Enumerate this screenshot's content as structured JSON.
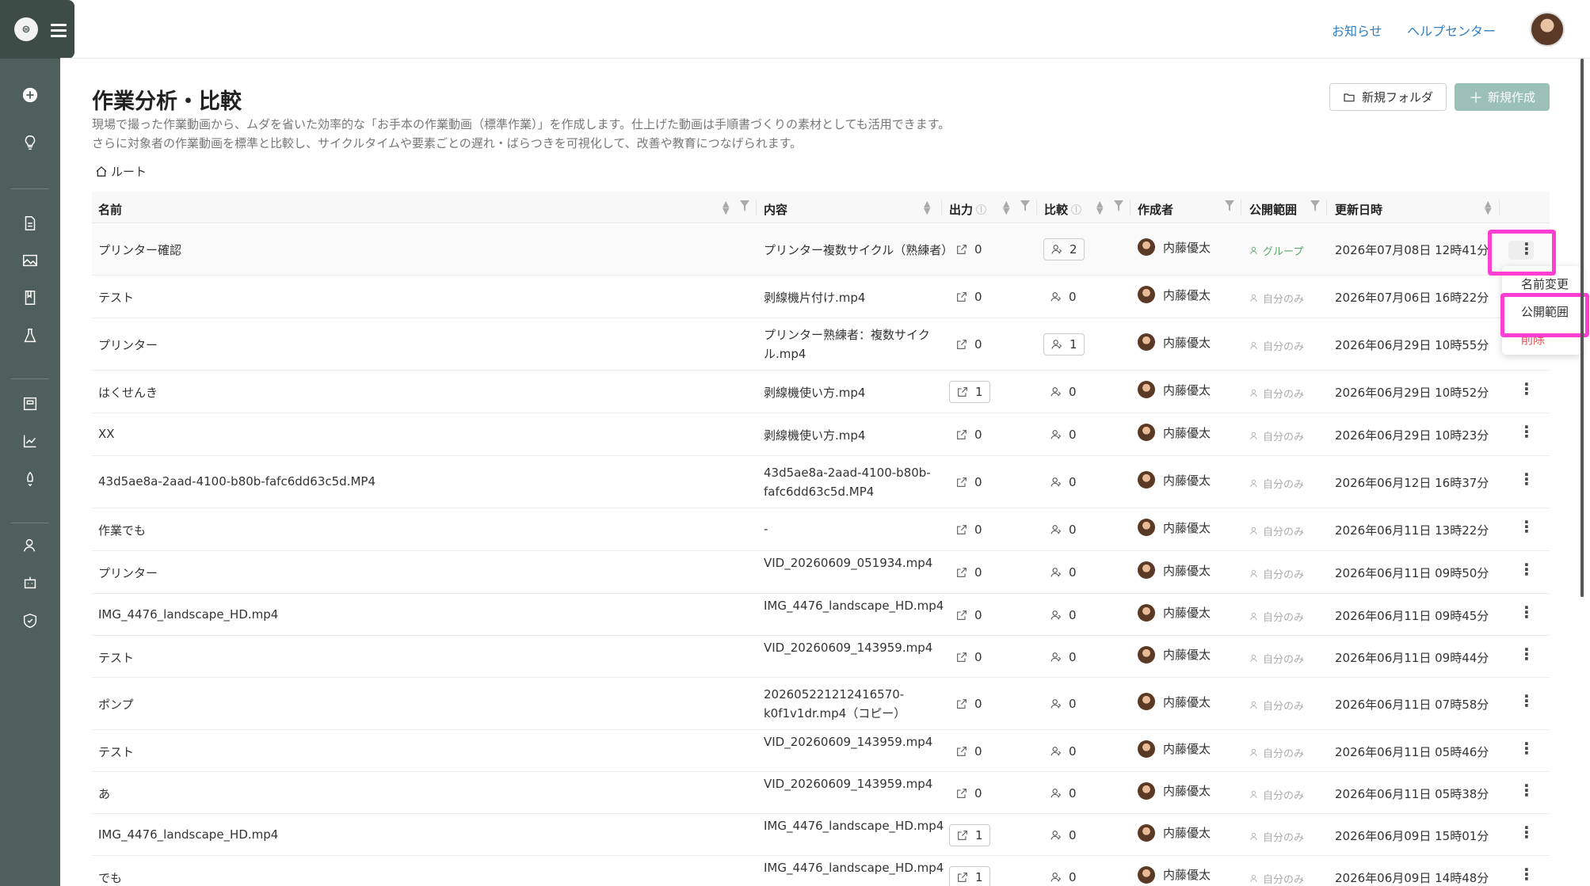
{
  "topbar": {
    "news": "お知らせ",
    "help": "ヘルプセンター"
  },
  "page": {
    "title": "作業分析・比較",
    "desc1": "現場で撮った作業動画から、ムダを省いた効率的な「お手本の作業動画（標準作業）」を作成します。仕上げた動画は手順書づくりの素材としても活用できます。",
    "desc2": "さらに対象者の作業動画を標準と比較し、サイクルタイムや要素ごとの遅れ・ばらつきを可視化して、改善や教育につなげられます。",
    "new_folder": "新規フォルダ",
    "new_create": "新規作成",
    "breadcrumb_root": "ルート"
  },
  "table": {
    "headers": {
      "name": "名前",
      "content": "内容",
      "output": "出力",
      "compare": "比較",
      "author": "作成者",
      "scope": "公開範囲",
      "updated": "更新日時"
    },
    "rows": [
      {
        "name": "プリンター確認",
        "content": "プリンター複数サイクル（熟練者）",
        "output": "0",
        "compare": "2",
        "author": "内藤優太",
        "scope": "グループ",
        "updated": "2026年07月08日 12時41分"
      },
      {
        "name": "テスト",
        "content": "剥線機片付け.mp4",
        "output": "0",
        "compare": "0",
        "author": "内藤優太",
        "scope": "自分のみ",
        "updated": "2026年07月06日 16時22分"
      },
      {
        "name": "プリンター",
        "content": "プリンター熟練者：複数サイクル.mp4",
        "output": "0",
        "compare": "1",
        "author": "内藤優太",
        "scope": "自分のみ",
        "updated": "2026年06月29日 10時55分"
      },
      {
        "name": "はくせんき",
        "content": "剥線機使い方.mp4",
        "output": "1",
        "compare": "0",
        "author": "内藤優太",
        "scope": "自分のみ",
        "updated": "2026年06月29日 10時52分"
      },
      {
        "name": "XX",
        "content": "剥線機使い方.mp4",
        "output": "0",
        "compare": "0",
        "author": "内藤優太",
        "scope": "自分のみ",
        "updated": "2026年06月29日 10時23分"
      },
      {
        "name": "43d5ae8a-2aad-4100-b80b-fafc6dd63c5d.MP4",
        "content": "43d5ae8a-2aad-4100-b80b-fafc6dd63c5d.MP4",
        "output": "0",
        "compare": "0",
        "author": "内藤優太",
        "scope": "自分のみ",
        "updated": "2026年06月12日 16時37分"
      },
      {
        "name": "作業でも",
        "content": "-",
        "output": "0",
        "compare": "0",
        "author": "内藤優太",
        "scope": "自分のみ",
        "updated": "2026年06月11日 13時22分"
      },
      {
        "name": "プリンター",
        "content": "VID_20260609_051934.mp4",
        "output": "0",
        "compare": "0",
        "author": "内藤優太",
        "scope": "自分のみ",
        "updated": "2026年06月11日 09時50分"
      },
      {
        "name": "IMG_4476_landscape_HD.mp4",
        "content": "IMG_4476_landscape_HD.mp4",
        "output": "0",
        "compare": "0",
        "author": "内藤優太",
        "scope": "自分のみ",
        "updated": "2026年06月11日 09時45分"
      },
      {
        "name": "テスト",
        "content": "VID_20260609_143959.mp4",
        "output": "0",
        "compare": "0",
        "author": "内藤優太",
        "scope": "自分のみ",
        "updated": "2026年06月11日 09時44分"
      },
      {
        "name": "ポンプ",
        "content": "202605221212416570-k0f1v1dr.mp4（コピー）",
        "output": "0",
        "compare": "0",
        "author": "内藤優太",
        "scope": "自分のみ",
        "updated": "2026年06月11日 07時58分"
      },
      {
        "name": "テスト",
        "content": "VID_20260609_143959.mp4",
        "output": "0",
        "compare": "0",
        "author": "内藤優太",
        "scope": "自分のみ",
        "updated": "2026年06月11日 05時46分"
      },
      {
        "name": "あ",
        "content": "VID_20260609_143959.mp4",
        "output": "0",
        "compare": "0",
        "author": "内藤優太",
        "scope": "自分のみ",
        "updated": "2026年06月11日 05時38分"
      },
      {
        "name": "IMG_4476_landscape_HD.mp4",
        "content": "IMG_4476_landscape_HD.mp4",
        "output": "1",
        "compare": "0",
        "author": "内藤優太",
        "scope": "自分のみ",
        "updated": "2026年06月09日 15時01分"
      },
      {
        "name": "でも",
        "content": "IMG_4476_landscape_HD.mp4",
        "output": "1",
        "compare": "0",
        "author": "内藤優太",
        "scope": "自分のみ",
        "updated": "2026年06月09日 14時48分"
      }
    ]
  },
  "menu": {
    "rename": "名前変更",
    "scope": "公開範囲",
    "delete": "削除"
  },
  "colors": {
    "sidebar": "#4f5f5b",
    "accent": "#9bc0b8",
    "link": "#2f7fc1",
    "highlight": "#ff3fd2",
    "group": "#5aa86a"
  },
  "icons": [
    "add-icon",
    "lightbulb-icon",
    "document-icon",
    "image-icon",
    "book-icon",
    "flask-icon",
    "board-icon",
    "chart-icon",
    "rocket-icon",
    "user-icon",
    "robot-icon",
    "shield-icon",
    "folder-icon",
    "home-icon",
    "external-link-icon",
    "compare-icon",
    "kebab-icon"
  ]
}
